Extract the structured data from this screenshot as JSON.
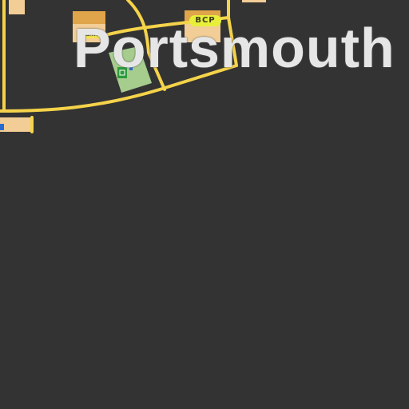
{
  "map": {
    "place_label": "Portsmouth",
    "poi_tag": "ame",
    "bcp_badge": "BCP",
    "colors": {
      "background": "#333333",
      "road": "#f5d34a",
      "building": "#f2cd96",
      "building_dark": "#e0a44a",
      "park": "#a6cc8e",
      "pitch_icon": "#2e9a3c",
      "info_icon": "#2a6bd1",
      "label": "#e6e6e6"
    }
  }
}
